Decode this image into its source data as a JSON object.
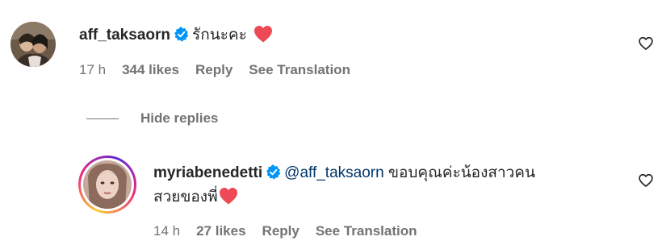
{
  "comments": [
    {
      "username": "aff_taksaorn",
      "verified": true,
      "text": "รักนะคะ",
      "has_heart": true,
      "time": "17 h",
      "likes": "344 likes",
      "reply": "Reply",
      "translate": "See Translation",
      "icon": "heart-outline-icon"
    }
  ],
  "replies_toggle": {
    "label": "Hide replies"
  },
  "replies": [
    {
      "username": "myriabenedetti",
      "verified": true,
      "mention": "@aff_taksaorn",
      "text_line1": "ขอบคุณค่ะน้องสาวคน",
      "text_line2": "สวยของพี่",
      "has_heart": true,
      "time": "14 h",
      "likes": "27 likes",
      "reply": "Reply",
      "translate": "See Translation",
      "icon": "heart-outline-icon"
    }
  ],
  "colors": {
    "verified": "#0095f6",
    "heart": "#ed4956",
    "meta_text": "#737373",
    "mention": "#00376b"
  }
}
